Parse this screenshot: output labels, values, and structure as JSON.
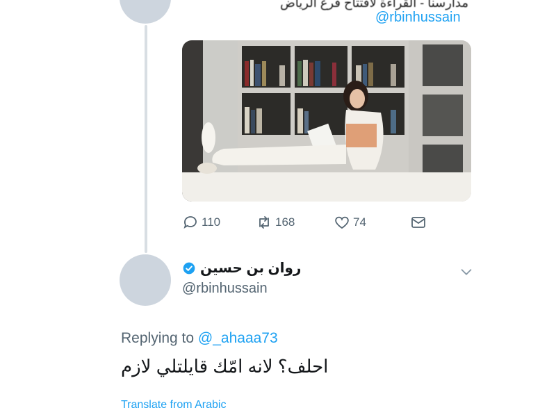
{
  "original_tweet": {
    "partial_text": "مدارسنا - القراءة لافتتاح فرع الرياض",
    "handle": "@rbinhussain",
    "media": {
      "alt": "photo-woman-reading-bookshelf"
    }
  },
  "actions": {
    "reply_count": "110",
    "retweet_count": "168",
    "like_count": "74"
  },
  "reply_tweet": {
    "display_name": "روان بن حسين",
    "handle": "@rbinhussain",
    "replying_label": "Replying to",
    "replying_to": "@_ahaaa73",
    "text": "احلف؟ لانه امّك قايلتلي لازم",
    "translate_label": "Translate from Arabic"
  },
  "colors": {
    "link": "#1da1f2",
    "muted": "#536471",
    "thread_line": "#d8dee3",
    "avatar": "#cdd5de"
  }
}
